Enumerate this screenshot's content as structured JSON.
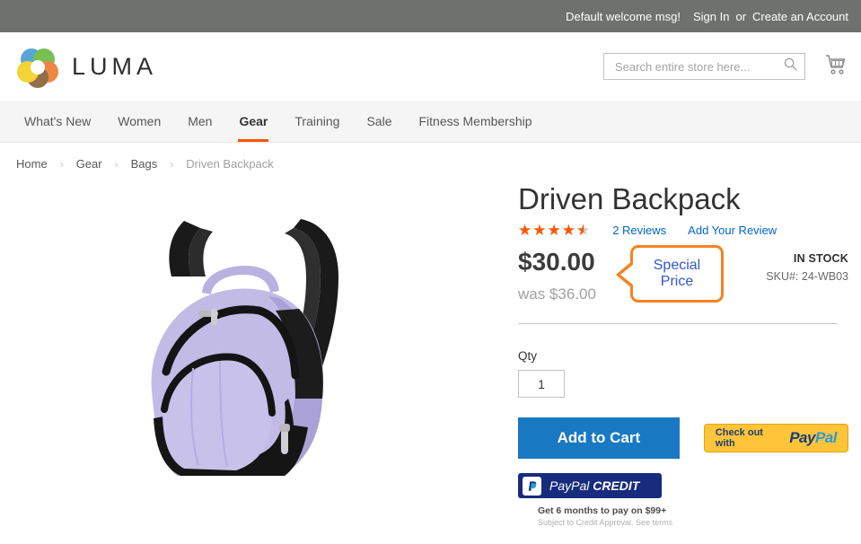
{
  "topbar": {
    "welcome": "Default welcome msg!",
    "sign_in": "Sign In",
    "separator": "or",
    "create_account": "Create an Account"
  },
  "header": {
    "logo_text": "LUMA",
    "logo_icon": "luma-flower-logo",
    "search": {
      "placeholder": "Search entire store here...",
      "value": "",
      "icon": "search-icon"
    },
    "cart_icon": "shopping-cart-icon"
  },
  "nav": {
    "items": [
      {
        "label": "What's New",
        "active": false
      },
      {
        "label": "Women",
        "active": false
      },
      {
        "label": "Men",
        "active": false
      },
      {
        "label": "Gear",
        "active": true
      },
      {
        "label": "Training",
        "active": false
      },
      {
        "label": "Sale",
        "active": false
      },
      {
        "label": "Fitness Membership",
        "active": false
      }
    ],
    "active_color": "#ff5501"
  },
  "breadcrumb": {
    "items": [
      "Home",
      "Gear",
      "Bags",
      "Driven Backpack"
    ],
    "separator": "›"
  },
  "product": {
    "title": "Driven Backpack",
    "image_alt": "lavender and black driven backpack",
    "rating": {
      "stars_filled": 4.5,
      "stars_total": 5,
      "star_color": "#ff5501",
      "reviews_link": "2 Reviews",
      "add_review_link": "Add Your Review"
    },
    "price": {
      "current": "$30.00",
      "old_label": "was",
      "old_value": "$36.00"
    },
    "callout": {
      "line1": "Special",
      "line2": "Price",
      "border_color": "#f58220",
      "text_color": "#3355cc"
    },
    "availability": "IN STOCK",
    "sku_label": "SKU#:",
    "sku_value": "24-WB03",
    "qty_label": "Qty",
    "qty_value": "1"
  },
  "actions": {
    "add_to_cart": "Add to Cart",
    "paypal": {
      "prefix": "Check out with",
      "word_pay": "Pay",
      "word_pal": "Pal",
      "bg_color": "#ffc439"
    },
    "paypal_credit": {
      "badge_icon": "paypal-monogram-icon",
      "word_paypal": "PayPal",
      "word_credit": "CREDIT",
      "promo_line": "Get 6 months to pay on $99+",
      "terms_line": "Subject to Credit Approval. See terms"
    }
  }
}
